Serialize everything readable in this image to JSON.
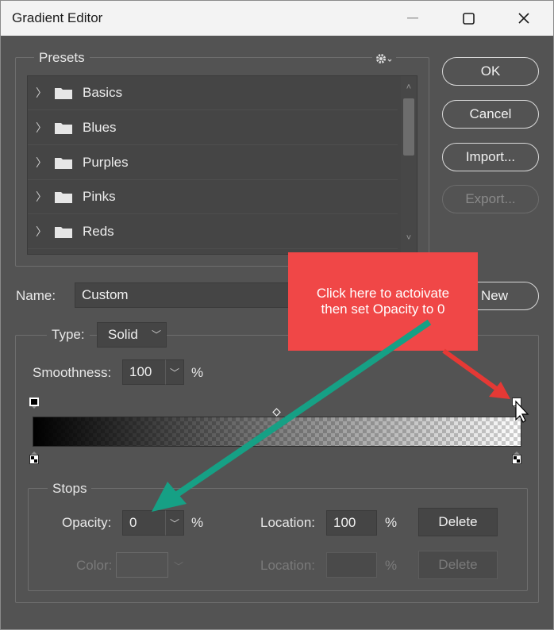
{
  "window": {
    "title": "Gradient Editor",
    "minimize_glyph": "—",
    "close_glyph": "✕"
  },
  "presets": {
    "legend": "Presets",
    "gear_glyph": "⚙▾",
    "items": [
      {
        "label": "Basics"
      },
      {
        "label": "Blues"
      },
      {
        "label": "Purples"
      },
      {
        "label": "Pinks"
      },
      {
        "label": "Reds"
      }
    ],
    "scroll_up": "˄",
    "scroll_down": "˅"
  },
  "buttons": {
    "ok": "OK",
    "cancel": "Cancel",
    "import": "Import...",
    "export": "Export...",
    "new": "New"
  },
  "name": {
    "label": "Name:",
    "value": "Custom"
  },
  "gradient": {
    "type_label": "Type:",
    "type_value": "Solid",
    "smoothness_label": "Smoothness:",
    "smoothness_value": "100",
    "percent": "%",
    "from_color": "#000000",
    "start_opacity": 1,
    "end_opacity": 0
  },
  "stops": {
    "legend": "Stops",
    "opacity_label": "Opacity:",
    "opacity_value": "0",
    "opacity_unit": "%",
    "location_label": "Location:",
    "location_value": "100",
    "location_unit": "%",
    "delete_label": "Delete",
    "color_label": "Color:",
    "color_location_label": "Location:",
    "color_location_unit": "%",
    "color_delete_label": "Delete"
  },
  "annotation": {
    "line1": "Click here to actoivate",
    "line2": "then set Opacity to 0",
    "callout_color": "#f04747",
    "arrow_red": "#e53935",
    "arrow_green": "#16a085"
  },
  "icons": {
    "chevron_right": "〉",
    "chevron_down": "﹀"
  }
}
